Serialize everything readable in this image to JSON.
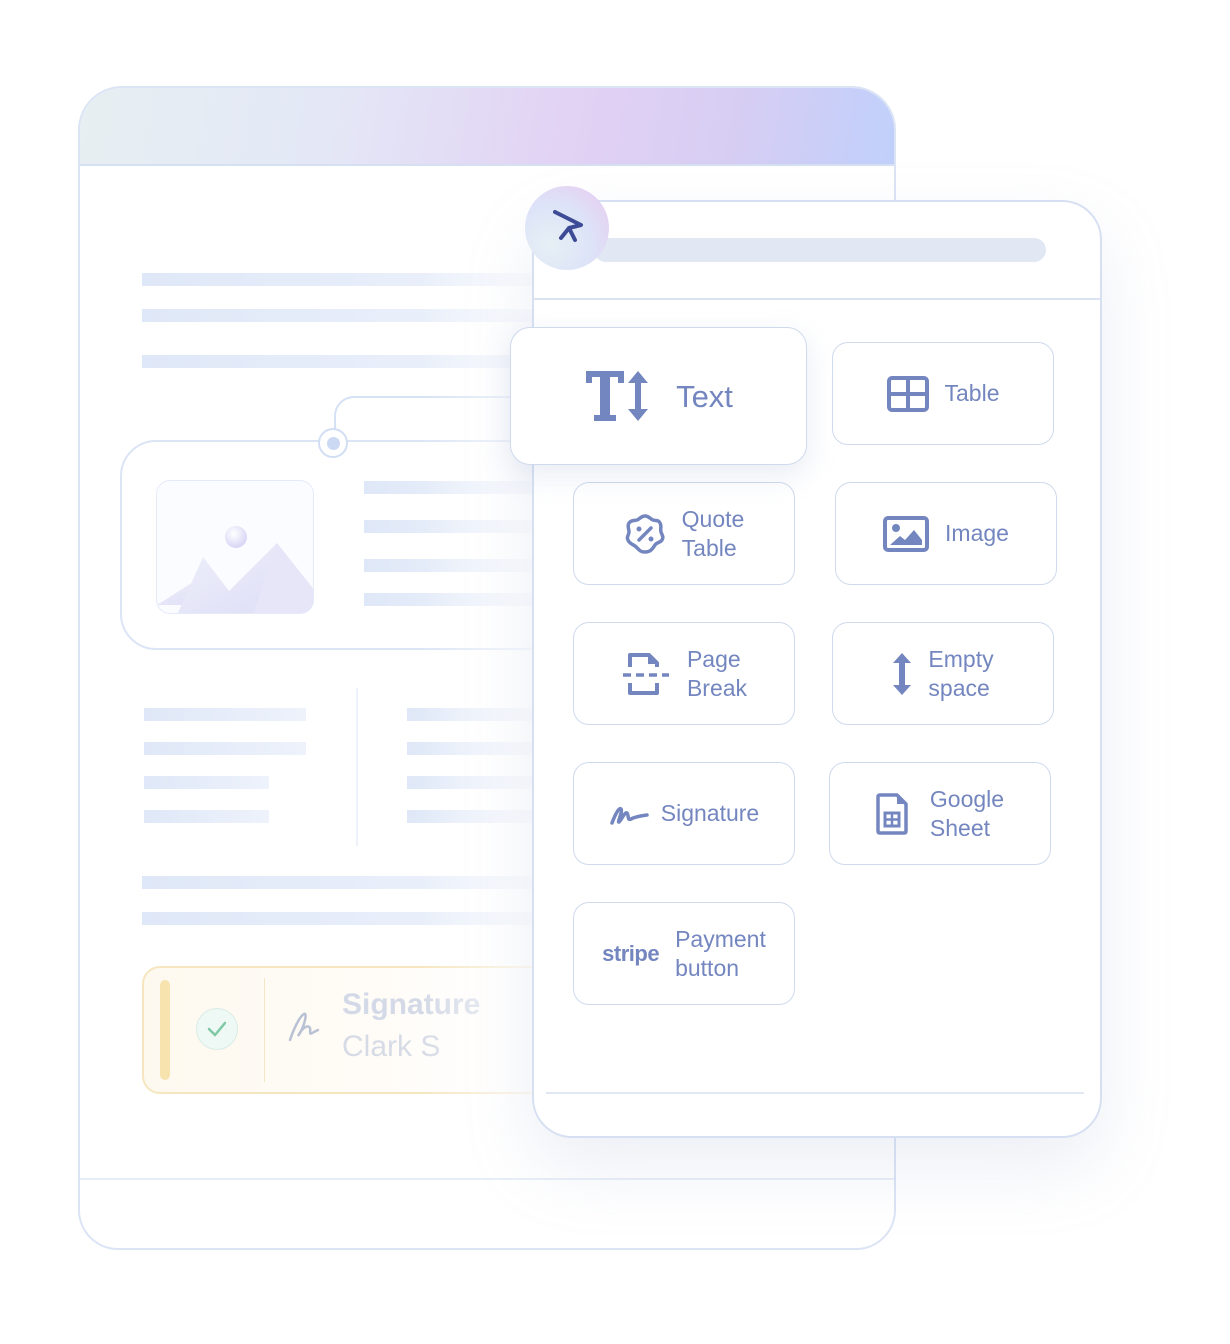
{
  "app": {
    "accent_color": "#7486bf",
    "border_color": "#cfdaed"
  },
  "document": {
    "signature_block": {
      "title": "Signature",
      "signer": "Clark S",
      "status": "signed"
    }
  },
  "panel": {
    "search_placeholder": "",
    "blocks": [
      {
        "id": "text",
        "label": "Text",
        "icon": "text-height-icon",
        "highlighted": true
      },
      {
        "id": "table",
        "label": "Table",
        "icon": "table-icon"
      },
      {
        "id": "quote-table",
        "label": "Quote\nTable",
        "icon": "discount-badge-icon"
      },
      {
        "id": "image",
        "label": "Image",
        "icon": "image-icon"
      },
      {
        "id": "page-break",
        "label": "Page\nBreak",
        "icon": "page-break-icon"
      },
      {
        "id": "empty-space",
        "label": "Empty\nspace",
        "icon": "vertical-arrows-icon"
      },
      {
        "id": "signature",
        "label": "Signature",
        "icon": "signature-icon"
      },
      {
        "id": "google-sheet",
        "label": "Google\nSheet",
        "icon": "spreadsheet-icon"
      },
      {
        "id": "payment-button",
        "label": "Payment\nbutton",
        "icon": "stripe-logo",
        "logo_text": "stripe"
      }
    ]
  }
}
